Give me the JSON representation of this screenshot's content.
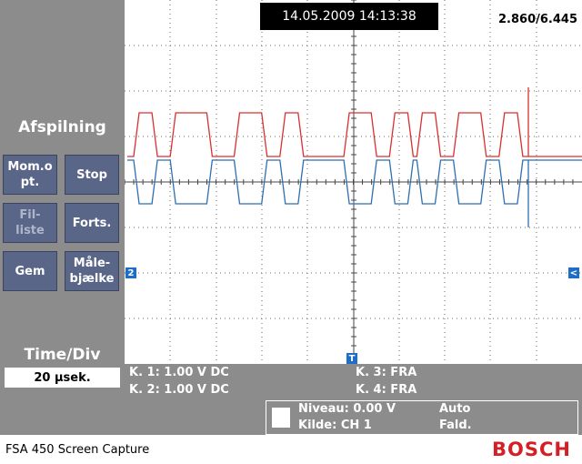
{
  "header": {
    "datetime": "14.05.2009 14:13:38",
    "cursor_readout": "2.860/6.445"
  },
  "sidebar": {
    "title": "Afspilning",
    "buttons": [
      {
        "label": "Mom.o\npt.",
        "enabled": true
      },
      {
        "label": "Stop",
        "enabled": true
      },
      {
        "label": "Fil-\nliste",
        "enabled": false
      },
      {
        "label": "Forts.",
        "enabled": true
      },
      {
        "label": "Gem",
        "enabled": true
      },
      {
        "label": "Måle-\nbjælke",
        "enabled": true
      }
    ],
    "timediv_label": "Time/Div",
    "timediv_value": "20 µsek."
  },
  "markers": {
    "channel2": "2",
    "trigger": "T",
    "right_arrow": "<"
  },
  "channels": {
    "k1": "K. 1: 1.00 V DC",
    "k2": "K. 2: 1.00 V DC",
    "k3": "K. 3: FRA",
    "k4": "K. 4: FRA"
  },
  "trigger": {
    "level": "Niveau: 0.00 V",
    "source": "Kilde: CH 1",
    "mode": "Auto",
    "slope": "Fald."
  },
  "footer": {
    "label": "FSA 450 Screen Capture",
    "brand": "BOSCH"
  },
  "colors": {
    "channel1": "#d9302f",
    "channel2": "#2f6fb0",
    "button_bg": "#5a6688",
    "panel_bg": "#8c8c8c",
    "brand": "#d51f24"
  },
  "signal": {
    "pattern": [
      0,
      1,
      1,
      0,
      0,
      1,
      1,
      1,
      1,
      0,
      0,
      0,
      1,
      1,
      1,
      0,
      0,
      1,
      1,
      0,
      0,
      0,
      0,
      0,
      1,
      1,
      1,
      0,
      0,
      1,
      1,
      0,
      1,
      1,
      0,
      0,
      1,
      1,
      1,
      0,
      0,
      1,
      1,
      0,
      0
    ]
  }
}
